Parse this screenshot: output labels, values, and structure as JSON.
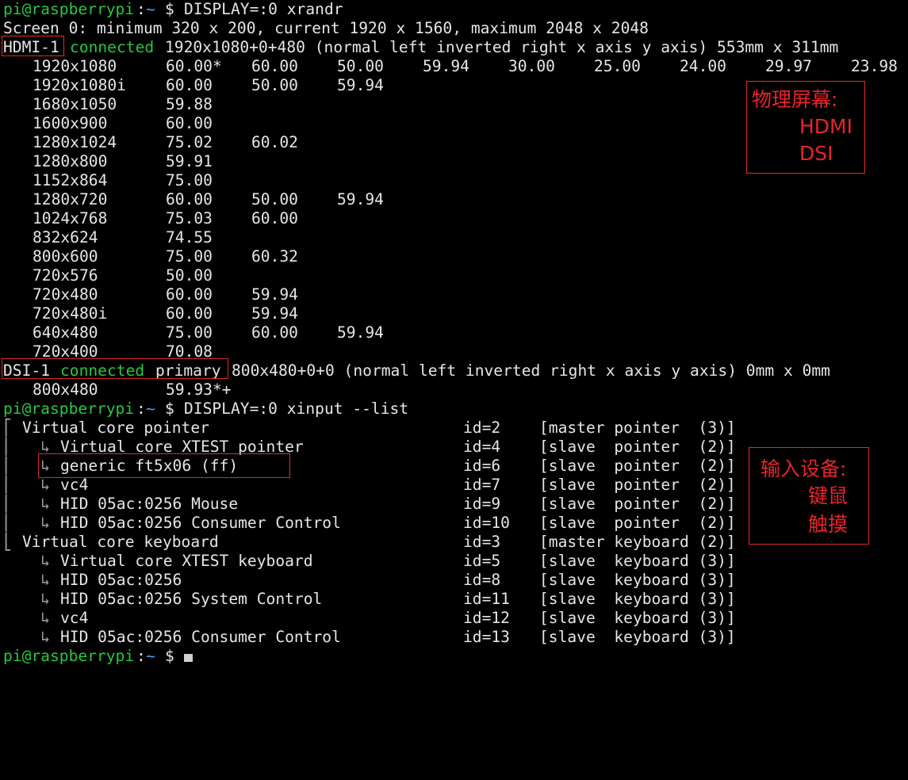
{
  "prompt": {
    "user_host": "pi@raspberrypi",
    "sep": ":",
    "path": "~",
    "symbol": "$"
  },
  "commands": {
    "xrandr": "DISPLAY=:0 xrandr",
    "xinput": "DISPLAY=:0 xinput --list"
  },
  "screen_line": "Screen 0: minimum 320 x 200, current 1920 x 1560, maximum 2048 x 2048",
  "hdmi": {
    "name": "HDMI-1",
    "status": "connected",
    "geometry": "1920x1080+0+480 (normal left inverted right x axis y axis) 553mm x 311mm"
  },
  "modes_hdmi": [
    {
      "res": "1920x1080",
      "rates": [
        "60.00*",
        "60.00",
        "50.00",
        "59.94",
        "30.00",
        "25.00",
        "24.00",
        "29.97",
        "23.98"
      ]
    },
    {
      "res": "1920x1080i",
      "rates": [
        "60.00",
        "50.00",
        "59.94"
      ]
    },
    {
      "res": "1680x1050",
      "rates": [
        "59.88"
      ]
    },
    {
      "res": "1600x900",
      "rates": [
        "60.00"
      ]
    },
    {
      "res": "1280x1024",
      "rates": [
        "75.02",
        "60.02"
      ]
    },
    {
      "res": "1280x800",
      "rates": [
        "59.91"
      ]
    },
    {
      "res": "1152x864",
      "rates": [
        "75.00"
      ]
    },
    {
      "res": "1280x720",
      "rates": [
        "60.00",
        "50.00",
        "59.94"
      ]
    },
    {
      "res": "1024x768",
      "rates": [
        "75.03",
        "60.00"
      ]
    },
    {
      "res": "832x624",
      "rates": [
        "74.55"
      ]
    },
    {
      "res": "800x600",
      "rates": [
        "75.00",
        "60.32"
      ]
    },
    {
      "res": "720x576",
      "rates": [
        "50.00"
      ]
    },
    {
      "res": "720x480",
      "rates": [
        "60.00",
        "59.94"
      ]
    },
    {
      "res": "720x480i",
      "rates": [
        "60.00",
        "59.94"
      ]
    },
    {
      "res": "640x480",
      "rates": [
        "75.00",
        "60.00",
        "59.94"
      ]
    },
    {
      "res": "720x400",
      "rates": [
        "70.08"
      ]
    }
  ],
  "dsi": {
    "name": "DSI-1",
    "status": "connected",
    "primary": "primary",
    "geometry": "800x480+0+0 (normal left inverted right x axis y axis) 0mm x 0mm"
  },
  "modes_dsi": [
    {
      "res": "800x480",
      "rates": [
        "59.93*+"
      ]
    }
  ],
  "xinput": [
    {
      "tree": "⎡ ",
      "name": "Virtual core pointer",
      "id": "id=2",
      "role": "[master pointer  (3)]"
    },
    {
      "tree": "⎜   ↳ ",
      "name": "Virtual core XTEST pointer",
      "id": "id=4",
      "role": "[slave  pointer  (2)]"
    },
    {
      "tree": "⎜   ↳ ",
      "name": "generic ft5x06 (ff)",
      "id": "id=6",
      "role": "[slave  pointer  (2)]"
    },
    {
      "tree": "⎜   ↳ ",
      "name": "vc4",
      "id": "id=7",
      "role": "[slave  pointer  (2)]"
    },
    {
      "tree": "⎜   ↳ ",
      "name": "HID 05ac:0256 Mouse",
      "id": "id=9",
      "role": "[slave  pointer  (2)]"
    },
    {
      "tree": "⎜   ↳ ",
      "name": "HID 05ac:0256 Consumer Control",
      "id": "id=10",
      "role": "[slave  pointer  (2)]"
    },
    {
      "tree": "⎣ ",
      "name": "Virtual core keyboard",
      "id": "id=3",
      "role": "[master keyboard (2)]"
    },
    {
      "tree": "    ↳ ",
      "name": "Virtual core XTEST keyboard",
      "id": "id=5",
      "role": "[slave  keyboard (3)]"
    },
    {
      "tree": "    ↳ ",
      "name": "HID 05ac:0256",
      "id": "id=8",
      "role": "[slave  keyboard (3)]"
    },
    {
      "tree": "    ↳ ",
      "name": "HID 05ac:0256 System Control",
      "id": "id=11",
      "role": "[slave  keyboard (3)]"
    },
    {
      "tree": "    ↳ ",
      "name": "vc4",
      "id": "id=12",
      "role": "[slave  keyboard (3)]"
    },
    {
      "tree": "    ↳ ",
      "name": "HID 05ac:0256 Consumer Control",
      "id": "id=13",
      "role": "[slave  keyboard (3)]"
    }
  ],
  "annotations": {
    "screens": {
      "title": "物理屏幕:",
      "items": [
        "HDMI",
        "DSI"
      ]
    },
    "inputs": {
      "title": "输入设备:",
      "items": [
        "键鼠",
        "触摸"
      ]
    }
  },
  "colors": {
    "background": "#000000",
    "text": "#e6e6e6",
    "prompt_green": "#26c940",
    "path_blue": "#4aa6f2",
    "annotation_red": "#e02a2a"
  }
}
